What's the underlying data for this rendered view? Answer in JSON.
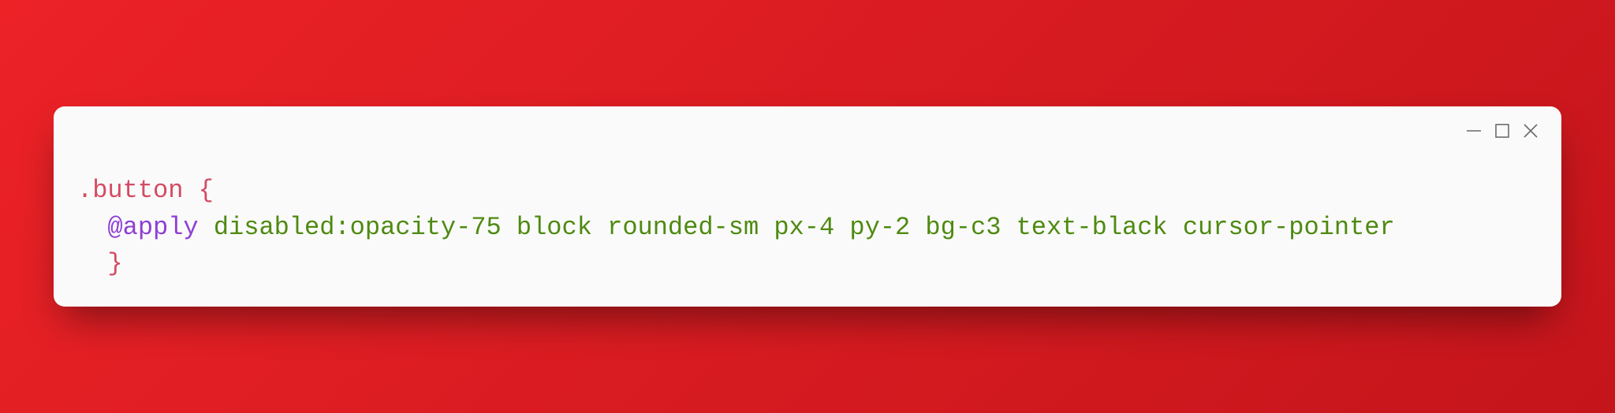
{
  "code": {
    "line1_selector": ".button",
    "line1_brace_open": " {",
    "line2_indent": "  ",
    "line2_atrule": "@apply",
    "line2_space": " ",
    "line2_value": "disabled:opacity-75 block rounded-sm px-4 py-2 bg-c3 text-black cursor-pointer",
    "line3_indent": "  ",
    "line3_brace_close": "}"
  },
  "controls": {
    "minimize": "minimize",
    "maximize": "maximize",
    "close": "close"
  }
}
